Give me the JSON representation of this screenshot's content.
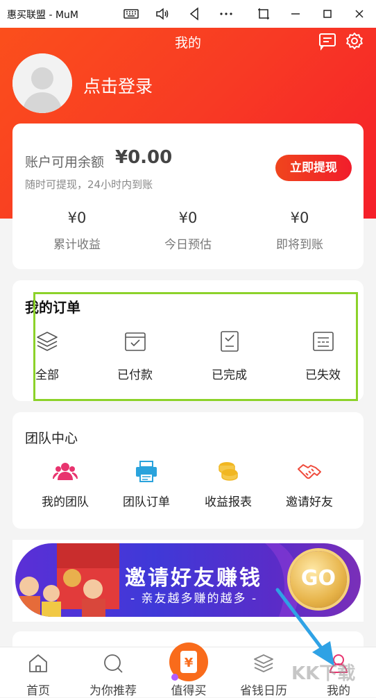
{
  "window": {
    "title": "惠买联盟 - MuM"
  },
  "header": {
    "title": "我的",
    "login_text": "点击登录"
  },
  "balance": {
    "label": "账户可用余额",
    "value": "¥0.00",
    "subtext": "随时可提现，24小时内到账",
    "withdraw_button": "立即提现",
    "stats": [
      {
        "value": "¥0",
        "label": "累计收益"
      },
      {
        "value": "¥0",
        "label": "今日预估"
      },
      {
        "value": "¥0",
        "label": "即将到账"
      }
    ]
  },
  "orders": {
    "title": "我的订单",
    "items": [
      {
        "label": "全部",
        "icon": "layers-icon"
      },
      {
        "label": "已付款",
        "icon": "paid-icon"
      },
      {
        "label": "已完成",
        "icon": "completed-icon"
      },
      {
        "label": "已失效",
        "icon": "expired-icon"
      }
    ]
  },
  "team": {
    "title": "团队中心",
    "items": [
      {
        "label": "我的团队",
        "icon": "team-icon",
        "color": "#e8336e"
      },
      {
        "label": "团队订单",
        "icon": "printer-icon",
        "color": "#2aa3dc"
      },
      {
        "label": "收益报表",
        "icon": "coins-icon",
        "color": "#f1b722"
      },
      {
        "label": "邀请好友",
        "icon": "handshake-icon",
        "color": "#ef4b3c"
      }
    ]
  },
  "banner": {
    "main": "邀请好友赚钱",
    "sub": "- 亲友越多赚的越多 -",
    "go": "GO"
  },
  "bottom_nav": [
    {
      "label": "首页",
      "icon": "home-icon"
    },
    {
      "label": "为你推荐",
      "icon": "search-icon"
    },
    {
      "label": "值得买",
      "icon": "yen-bag-icon"
    },
    {
      "label": "省钱日历",
      "icon": "layers-icon"
    },
    {
      "label": "我的",
      "icon": "user-icon",
      "active": true
    }
  ],
  "watermark": "KK下载",
  "colors": {
    "primary": "#f5352a",
    "highlight": "#8cd22a",
    "active_nav": "#e8336e"
  }
}
